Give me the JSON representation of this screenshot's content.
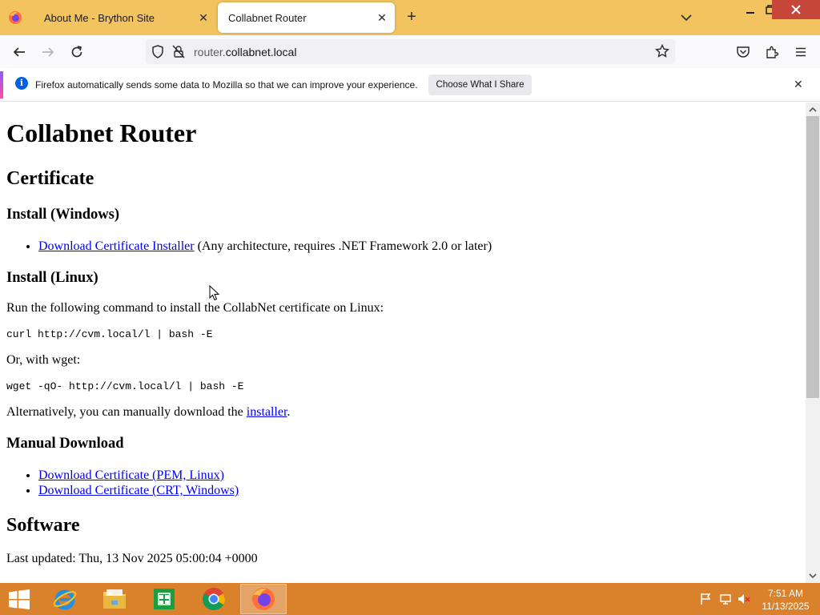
{
  "browser": {
    "tabs": [
      {
        "title": "About Me - Brython Site",
        "active": false
      },
      {
        "title": "Collabnet Router",
        "active": true
      }
    ],
    "url_prefix": "router.",
    "url_domain": "collabnet.local"
  },
  "notification": {
    "message": "Firefox automatically sends some data to Mozilla so that we can improve your experience.",
    "button": "Choose What I Share"
  },
  "page": {
    "title": "Collabnet Router",
    "certificate_heading": "Certificate",
    "install_windows_heading": "Install (Windows)",
    "windows_link": "Download Certificate Installer",
    "windows_note": " (Any architecture, requires .NET Framework 2.0 or later)",
    "install_linux_heading": "Install (Linux)",
    "linux_intro": "Run the following command to install the CollabNet certificate on Linux:",
    "curl_cmd": "curl http://cvm.local/l | bash -E",
    "wget_intro": "Or, with wget:",
    "wget_cmd": "wget -qO- http://cvm.local/l | bash -E",
    "alt_text_before": "Alternatively, you can manually download the ",
    "alt_link": "installer",
    "alt_text_after": ".",
    "manual_heading": "Manual Download",
    "manual_links": [
      "Download Certificate (PEM, Linux)",
      "Download Certificate (CRT, Windows)"
    ],
    "software_heading": "Software",
    "last_updated": "Last updated: Thu, 13 Nov 2025 05:00:04 +0000"
  },
  "taskbar": {
    "time": "7:51 AM",
    "date": "11/13/2025",
    "apps": [
      "internet-explorer",
      "file-explorer",
      "store",
      "chrome",
      "firefox"
    ]
  },
  "colors": {
    "tabstrip": "#f2c35e",
    "taskbar": "#d9822b",
    "link": "#0000ee"
  }
}
